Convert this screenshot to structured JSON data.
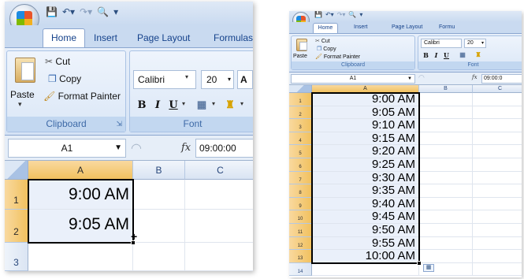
{
  "left": {
    "qat": {
      "save_icon": "save-icon",
      "undo_icon": "undo-icon",
      "redo_icon": "redo-icon",
      "preview_icon": "print-preview-icon",
      "more_icon": "customize-qat-icon"
    },
    "tabs": [
      "Home",
      "Insert",
      "Page Layout",
      "Formulas"
    ],
    "clipboard": {
      "paste": "Paste",
      "cut": "Cut",
      "copy": "Copy",
      "format_painter": "Format Painter",
      "group_label": "Clipboard"
    },
    "font": {
      "name": "Calibri",
      "size": "20",
      "group_label": "Font",
      "bold": "B",
      "italic": "I",
      "underline": "U"
    },
    "formula_bar": {
      "name_box": "A1",
      "fx": "fx",
      "value": "09:00:00"
    },
    "columns": [
      "A",
      "B",
      "C"
    ],
    "rows": [
      {
        "num": "1",
        "a": "9:00 AM"
      },
      {
        "num": "2",
        "a": "9:05 AM"
      },
      {
        "num": "3",
        "a": ""
      }
    ]
  },
  "right": {
    "tabs": [
      "Home",
      "Insert",
      "Page Layout",
      "Formu"
    ],
    "clipboard": {
      "paste": "Paste",
      "cut": "Cut",
      "copy": "Copy",
      "format_painter": "Format Painter",
      "group_label": "Clipboard"
    },
    "font": {
      "name": "Calibri",
      "size": "20",
      "group_label": "Font",
      "bold": "B",
      "italic": "I",
      "underline": "U"
    },
    "formula_bar": {
      "name_box": "A1",
      "fx": "fx",
      "value": "09:00:0"
    },
    "columns": [
      "A",
      "B",
      "C"
    ],
    "rows": [
      {
        "num": "1",
        "a": "9:00 AM"
      },
      {
        "num": "2",
        "a": "9:05 AM"
      },
      {
        "num": "3",
        "a": "9:10 AM"
      },
      {
        "num": "4",
        "a": "9:15 AM"
      },
      {
        "num": "5",
        "a": "9:20 AM"
      },
      {
        "num": "6",
        "a": "9:25 AM"
      },
      {
        "num": "7",
        "a": "9:30 AM"
      },
      {
        "num": "8",
        "a": "9:35 AM"
      },
      {
        "num": "9",
        "a": "9:40 AM"
      },
      {
        "num": "10",
        "a": "9:45 AM"
      },
      {
        "num": "11",
        "a": "9:50 AM"
      },
      {
        "num": "12",
        "a": "9:55 AM"
      },
      {
        "num": "13",
        "a": "10:00 AM"
      },
      {
        "num": "14",
        "a": ""
      }
    ]
  },
  "colors": {
    "selection_header": "#f1c15f",
    "ribbon": "#dbe7f7",
    "tab_text": "#15428b"
  }
}
